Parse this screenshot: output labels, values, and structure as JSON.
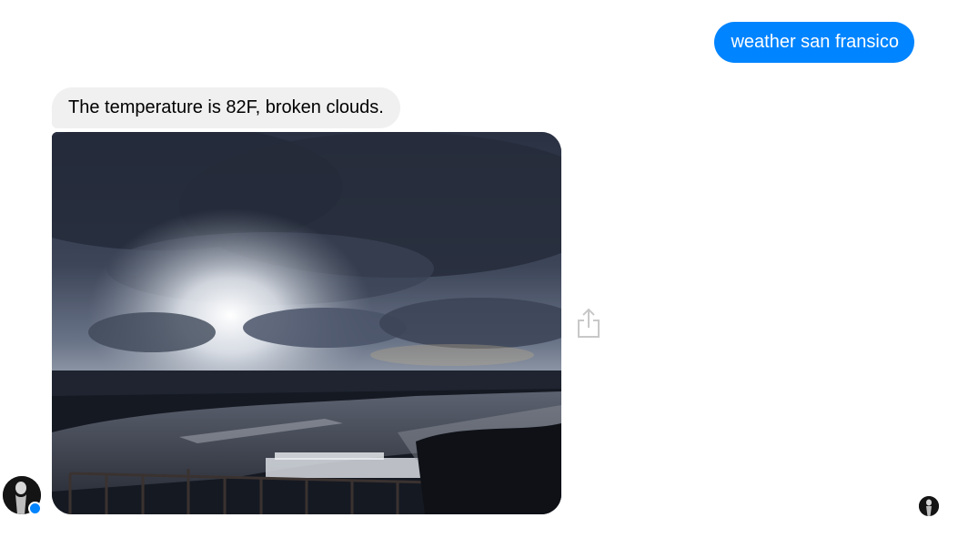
{
  "conversation": {
    "outgoing": [
      {
        "text": "weather san fransico"
      }
    ],
    "incoming": [
      {
        "text": "The temperature is 82F, broken clouds."
      }
    ]
  },
  "photo": {
    "subject": "cloudy sky over river photo"
  },
  "icons": {
    "share": "share-icon",
    "bot_avatar": "bot-avatar",
    "messenger_badge": "messenger-badge-icon",
    "seen_indicator": "seen-avatar"
  },
  "colors": {
    "outgoing_bubble": "#0084ff",
    "incoming_bubble": "#f0f0f0",
    "share_icon": "#c8c8c8"
  }
}
